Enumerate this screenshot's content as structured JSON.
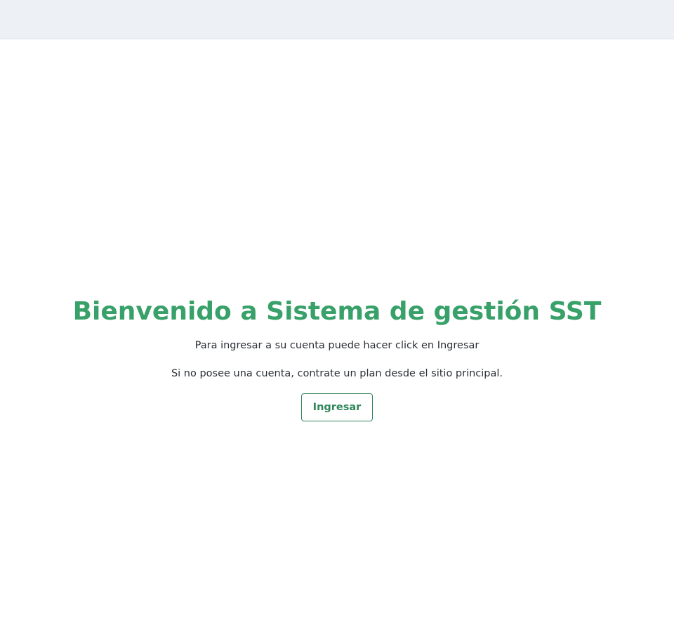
{
  "header": {
    "background_color": "#edf1f5"
  },
  "main": {
    "title": "Bienvenido a Sistema de gestión SST",
    "instruction": "Para ingresar a su cuenta puede hacer click en Ingresar",
    "no_account_text": "Si no posee una cuenta, contrate un plan desde el sitio principal.",
    "login_button_label": "Ingresar"
  },
  "colors": {
    "accent": "#38a169",
    "button_border": "#2f855a",
    "text": "#2b2f36"
  }
}
